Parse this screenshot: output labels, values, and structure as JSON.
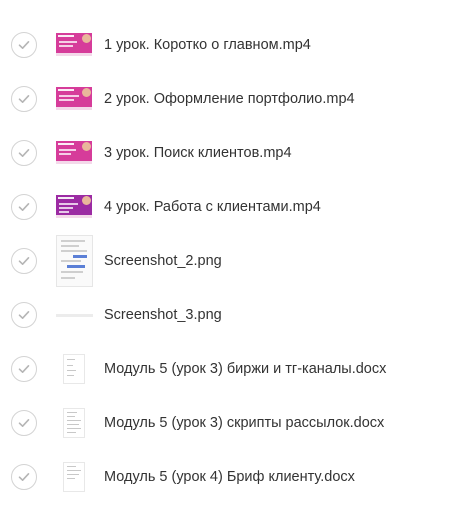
{
  "files": [
    {
      "name": "1 урок. Коротко о главном.mp4",
      "kind": "video",
      "icon": "video-thumbnail",
      "accent": "#d63c9a"
    },
    {
      "name": "2 урок. Оформление портфолио.mp4",
      "kind": "video",
      "icon": "video-thumbnail",
      "accent": "#d63c9a"
    },
    {
      "name": "3 урок. Поиск клиентов.mp4",
      "kind": "video",
      "icon": "video-thumbnail",
      "accent": "#d63c9a"
    },
    {
      "name": "4 урок. Работа с клиентами.mp4",
      "kind": "video",
      "icon": "video-thumbnail",
      "accent": "#9c2ba3"
    },
    {
      "name": "Screenshot_2.png",
      "kind": "image",
      "icon": "image-thumbnail"
    },
    {
      "name": "Screenshot_3.png",
      "kind": "image",
      "icon": "image-thumbnail"
    },
    {
      "name": "Модуль 5 (урок 3) биржи и тг-каналы.docx",
      "kind": "document",
      "icon": "document-thumbnail"
    },
    {
      "name": "Модуль 5 (урок 3) скрипты рассылок.docx",
      "kind": "document",
      "icon": "document-thumbnail"
    },
    {
      "name": "Модуль 5 (урок 4) Бриф клиенту.docx",
      "kind": "document",
      "icon": "document-thumbnail"
    }
  ],
  "colors": {
    "check_border": "#d3d3d3",
    "check_mark": "#b5b5b5",
    "text": "#333333"
  }
}
